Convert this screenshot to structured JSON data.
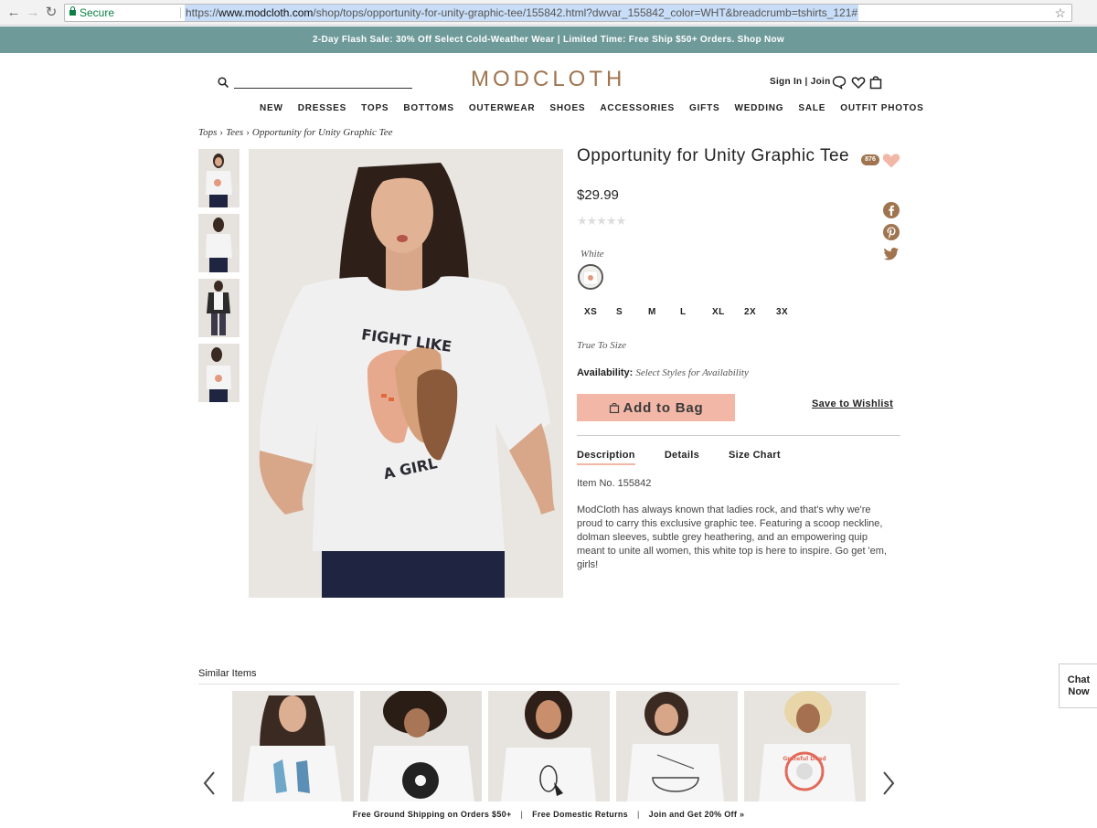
{
  "browser": {
    "secure_label": "Secure",
    "url_scheme": "https://",
    "url_host": "www.modcloth.com",
    "url_path": "/shop/tops/opportunity-for-unity-graphic-tee/155842.html?dwvar_155842_color=WHT&breadcrumb=tshirts_121#"
  },
  "promo": "2-Day Flash Sale: 30% Off Select Cold-Weather Wear | Limited Time: Free Ship $50+ Orders. Shop Now",
  "header": {
    "logo": "MODCLOTH",
    "sign_in": "Sign In",
    "join": "Join",
    "account_sep": "|"
  },
  "nav": [
    "NEW",
    "DRESSES",
    "TOPS",
    "BOTTOMS",
    "OUTERWEAR",
    "SHOES",
    "ACCESSORIES",
    "GIFTS",
    "WEDDING",
    "SALE",
    "OUTFIT PHOTOS"
  ],
  "breadcrumb": [
    "Tops",
    "Tees",
    "Opportunity for Unity Graphic Tee"
  ],
  "breadcrumb_sep": "›",
  "product": {
    "title": "Opportunity for Unity Graphic Tee",
    "price": "$29.99",
    "wishlist_count": "876",
    "rating_stars": "★★★★★",
    "color_name": "White",
    "sizes": [
      "XS",
      "S",
      "M",
      "L",
      "XL",
      "2X",
      "3X"
    ],
    "fit_note": "True To Size",
    "availability_label": "Availability:",
    "availability_value": "Select Styles for Availability",
    "add_to_bag": "Add to Bag",
    "save_to_wishlist": "Save to Wishlist",
    "tabs": [
      "Description",
      "Details",
      "Size Chart"
    ],
    "item_no": "Item No. 155842",
    "description": "ModCloth has always known that ladies rock, and that's why we're proud to carry this exclusive graphic tee. Featuring a scoop neckline, dolman sleeves, subtle grey heathering, and an empowering quip meant to unite all women, this white top is here to inspire. Go get 'em, girls!",
    "shirt_text_top": "FIGHT LIKE",
    "shirt_text_bottom": "A GIRL"
  },
  "similar": {
    "title": "Similar Items",
    "item_5_text": "Grateful Dead"
  },
  "chat": "Chat Now",
  "footer": [
    "Free Ground Shipping on Orders $50+",
    "Free Domestic Returns",
    "Join and Get 20% Off »"
  ],
  "footer_sep": "|",
  "colors": {
    "promo_bg": "#6f9a9a",
    "logo": "#a0744f",
    "add_to_bag_bg": "#f2b7a7",
    "heart": "#f2b7a7",
    "social": "#a0744f"
  }
}
